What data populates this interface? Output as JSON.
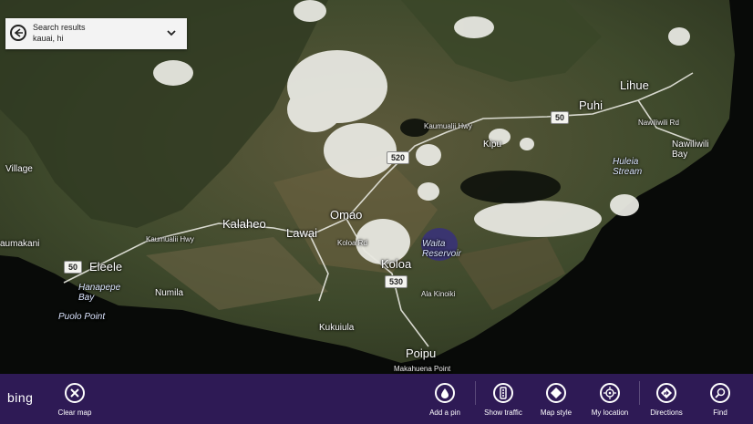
{
  "search": {
    "title": "Search results",
    "query": "kauai, hi"
  },
  "map": {
    "places": {
      "lihue": "Lihue",
      "puhi": "Puhi",
      "kipu": "Kipu",
      "huleia": "Huleia Stream",
      "nawiliwili": "Nawiliwili Bay",
      "omao": "Omao",
      "kalaheo": "Kalaheo",
      "lawai": "Lawai",
      "koloa": "Koloa",
      "eleele": "Eleele",
      "numila": "Numila",
      "kukuiula": "Kukuiula",
      "poipu": "Poipu",
      "village": "Village",
      "kaumakani": "aumakani",
      "hanapepe": "Hanapepe Bay",
      "puolo": "Puolo Point",
      "waita": "Waita Reservoir",
      "kaumualii": "Kaumualii Hwy",
      "kaumualii2": "Kaumualii Hwy",
      "nawiliwili_rd": "Nawiliwili Rd",
      "koloa_rd": "Koloa Rd",
      "ala_kinoiki": "Ala Kinoiki",
      "makahuena": "Makahuena Point"
    },
    "shields": {
      "r50a": "50",
      "r50b": "50",
      "r520": "520",
      "r530": "530"
    }
  },
  "appbar": {
    "brand": "bing",
    "clear_map": "Clear map",
    "add_pin": "Add a pin",
    "show_traffic": "Show traffic",
    "map_style": "Map style",
    "my_location": "My location",
    "directions": "Directions",
    "find": "Find"
  },
  "colors": {
    "appbar": "#2e1a55",
    "ocean": "#0c0f0a",
    "land": "#4a4a30"
  }
}
